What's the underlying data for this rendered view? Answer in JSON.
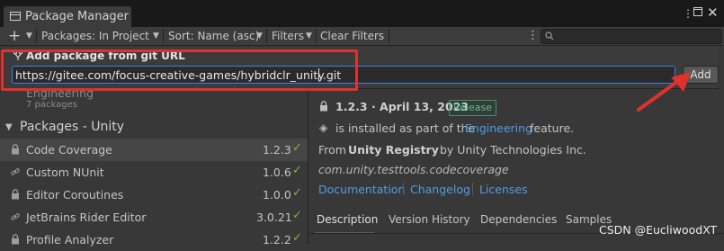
{
  "window": {
    "title": "Package Manager"
  },
  "toolbar": {
    "add_label": "+",
    "packages_dropdown": "Packages: In Project",
    "sort_dropdown": "Sort: Name (asc)",
    "filters_dropdown": "Filters",
    "clear_filters": "Clear Filters"
  },
  "git_popup": {
    "title": "Add package from git URL",
    "url_value": "https://gitee.com/focus-creative-games/hybridclr_unity.git",
    "add_button": "Add"
  },
  "packages": {
    "engineering_label": "Engineering",
    "engineering_count": "7 packages",
    "group_header": "Packages - Unity",
    "items": [
      {
        "name": "Code Coverage",
        "version": "1.2.3"
      },
      {
        "name": "Custom NUnit",
        "version": "1.0.6"
      },
      {
        "name": "Editor Coroutines",
        "version": "1.0.0"
      },
      {
        "name": "JetBrains Rider Editor",
        "version": "3.0.21"
      },
      {
        "name": "Profile Analyzer",
        "version": "1.2.2"
      }
    ]
  },
  "detail": {
    "version_line": "1.2.3 · April 13, 2023",
    "release_badge": "Release",
    "installed_text": "is installed as part of the",
    "installed_link": "Engineering",
    "installed_suffix": "feature.",
    "from_prefix": "From",
    "registry": "Unity Registry",
    "author": "by Unity Technologies Inc.",
    "package_id": "com.unity.testtools.codecoverage",
    "links": [
      "Documentation",
      "Changelog",
      "Licenses"
    ],
    "tabs": [
      "Description",
      "Version History",
      "Dependencies",
      "Samples"
    ]
  },
  "watermark": "CSDN @EucliwoodXT",
  "colors": {
    "accent": "#3d7ee8",
    "annotation_red": "#e0312d",
    "link": "#4e9ee8",
    "check": "#7fb24b"
  }
}
